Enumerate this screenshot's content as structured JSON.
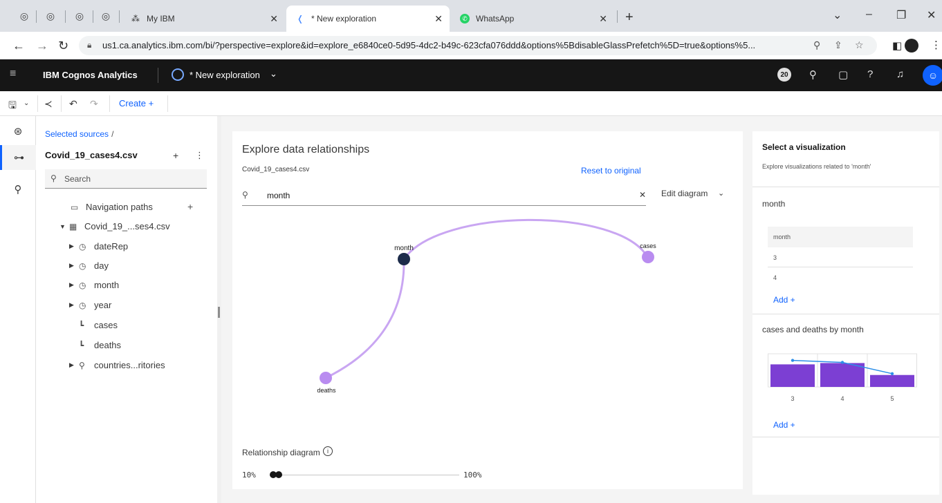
{
  "browser": {
    "tabs": [
      {
        "title": "My IBM",
        "active": false
      },
      {
        "title": "* New exploration",
        "active": true
      },
      {
        "title": "WhatsApp",
        "active": false
      }
    ],
    "new_tab_symbol": "+",
    "url": "us1.ca.analytics.ibm.com/bi/?perspective=explore&id=explore_e6840ce0-5d95-4dc2-b49c-623cfa076ddd&options%5BdisableGlassPrefetch%5D=true&options%5..."
  },
  "app": {
    "brand": "IBM Cognos Analytics",
    "exploration_title": "* New exploration",
    "notification_count": "20"
  },
  "toolbar": {
    "create_label": "Create +"
  },
  "source_panel": {
    "breadcrumb": "Selected sources",
    "breadcrumb_sep": "/",
    "source_name": "Covid_19_cases4.csv",
    "search_placeholder": "Search",
    "tree": [
      {
        "label": "Navigation paths",
        "icon": "folder-icon",
        "caret": ""
      },
      {
        "label": "Covid_19_...ses4.csv",
        "icon": "table-icon",
        "caret": "▼"
      },
      {
        "label": "dateRep",
        "icon": "clock-icon",
        "caret": "▶"
      },
      {
        "label": "day",
        "icon": "clock-icon",
        "caret": "▶"
      },
      {
        "label": "month",
        "icon": "clock-icon",
        "caret": "▶"
      },
      {
        "label": "year",
        "icon": "clock-icon",
        "caret": "▶"
      },
      {
        "label": "cases",
        "icon": "measure-icon",
        "caret": ""
      },
      {
        "label": "deaths",
        "icon": "measure-icon",
        "caret": ""
      },
      {
        "label": "countries...ritories",
        "icon": "location-icon",
        "caret": "▶"
      }
    ]
  },
  "explore": {
    "title": "Explore data relationships",
    "source": "Covid_19_cases4.csv",
    "reset_label": "Reset to original",
    "search_value": "month",
    "edit_diagram_label": "Edit diagram",
    "nodes": {
      "month": "month",
      "cases": "cases",
      "deaths": "deaths"
    },
    "colors": {
      "focus_node": "#1c2b4a",
      "node": "#b98cf0",
      "edge": "#c9a6f2"
    },
    "relationship_label": "Relationship diagram",
    "slider_min": "10%",
    "slider_max": "100%"
  },
  "viz_panel": {
    "title": "Select a visualization",
    "subtitle": "Explore visualizations related to 'month'",
    "card1_title": "month",
    "table_header": "month",
    "table_rows": [
      "3",
      "4"
    ],
    "add_label": "Add +",
    "card2_title": "cases and deaths by month"
  },
  "chart_data": {
    "type": "bar",
    "title": "cases and deaths by month",
    "categories": [
      "3",
      "4",
      "5"
    ],
    "series": [
      {
        "type": "bar",
        "values": [
          34,
          36,
          18
        ],
        "color": "#7c3fd3"
      },
      {
        "type": "line",
        "values": [
          40,
          37,
          20
        ],
        "color": "#2d8fe8"
      }
    ],
    "ylim": [
      0,
      50
    ],
    "grid": true
  }
}
